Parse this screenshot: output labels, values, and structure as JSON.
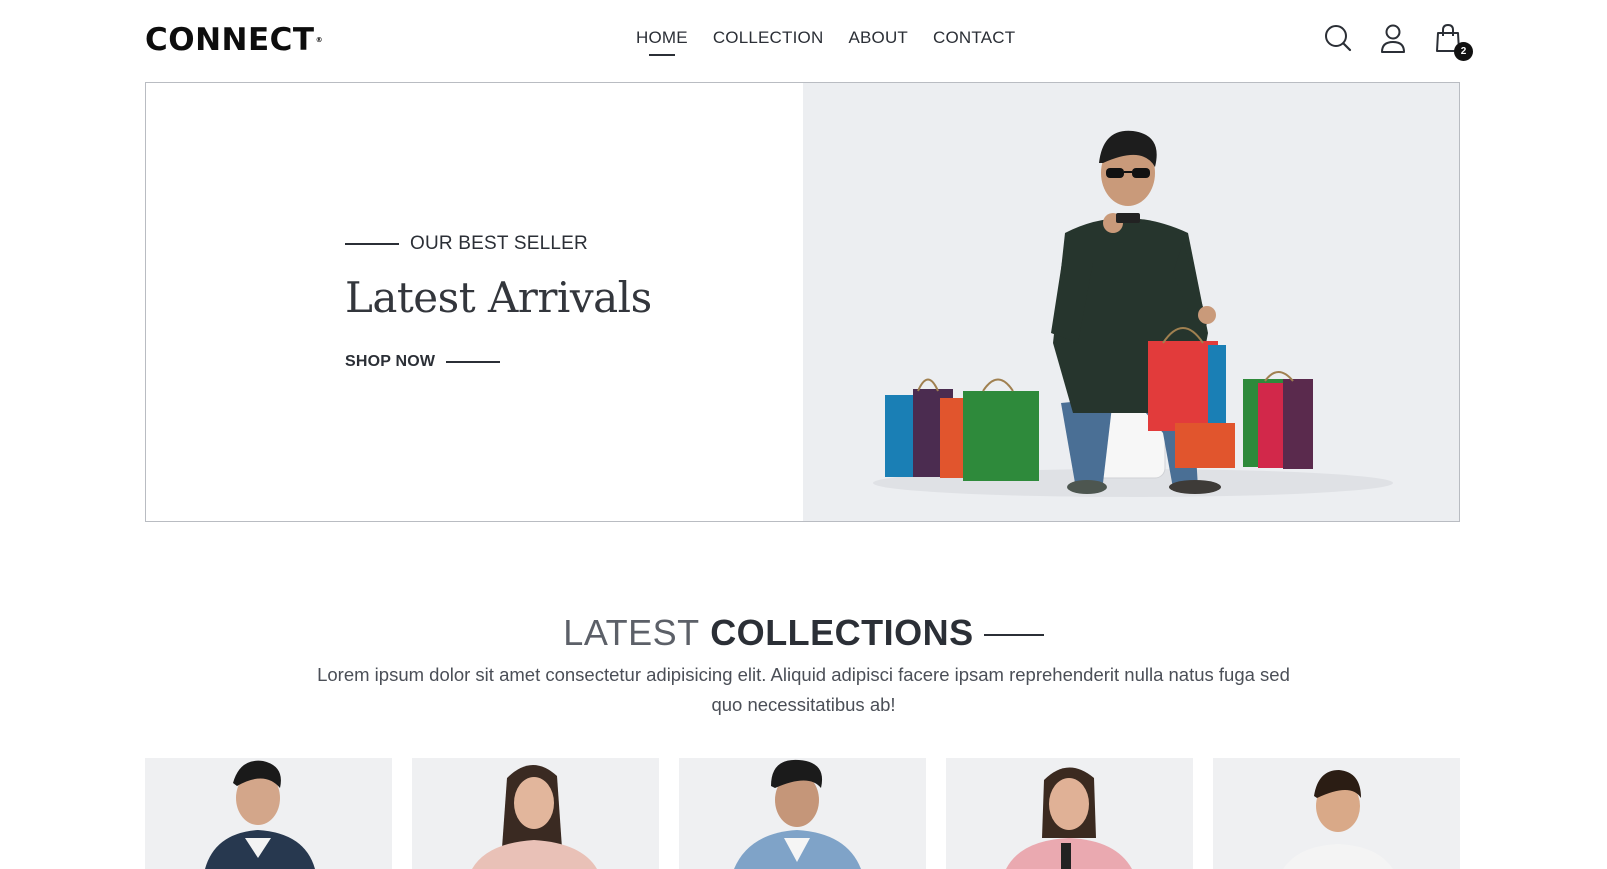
{
  "header": {
    "logo": "CONNECT",
    "logo_mark": "®",
    "nav": [
      {
        "label": "HOME",
        "active": true
      },
      {
        "label": "COLLECTION",
        "active": false
      },
      {
        "label": "ABOUT",
        "active": false
      },
      {
        "label": "CONTACT",
        "active": false
      }
    ],
    "icons": [
      "search-icon",
      "user-icon",
      "bag-icon"
    ],
    "cart_count": "2"
  },
  "hero": {
    "eyebrow": "OUR BEST SELLER",
    "title": "Latest Arrivals",
    "cta": "SHOP NOW"
  },
  "collections": {
    "title_light": "LATEST",
    "title_bold": "COLLECTIONS",
    "description": "Lorem ipsum dolor sit amet consectetur adipisicing elit. Aliquid adipisci facere ipsam reprehenderit nulla natus fuga sed quo necessitatibus ab!"
  },
  "products": [
    {
      "name": "product-denim-jacket-men"
    },
    {
      "name": "product-pink-top-women"
    },
    {
      "name": "product-denim-jacket-curly"
    },
    {
      "name": "product-pink-jacket-women"
    },
    {
      "name": "product-kids-tshirt"
    }
  ],
  "colors": {
    "text": "#2b2f36",
    "badge": "#111111",
    "hero_bg": "#eceef1",
    "card_bg": "#eff0f2"
  }
}
